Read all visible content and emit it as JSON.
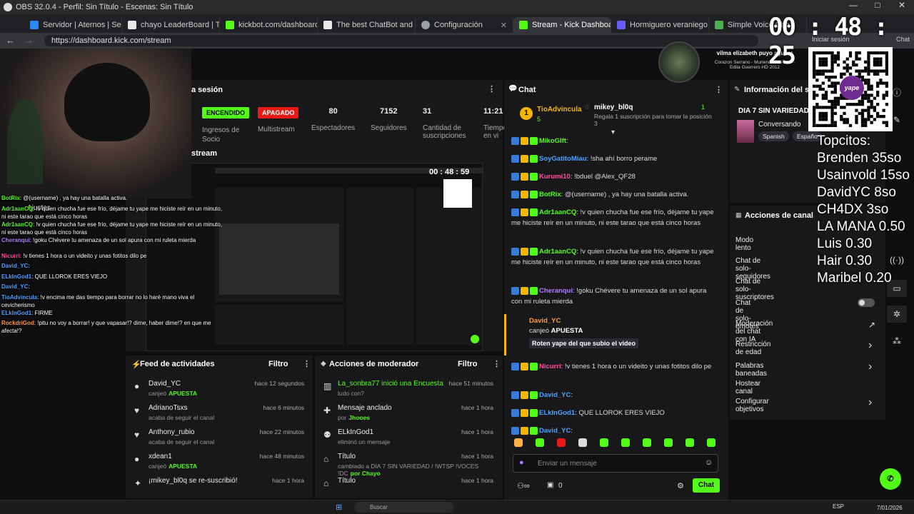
{
  "titlebar": {
    "title": "OBS 32.0.4 - Perfil: Sin Título - Escenas: Sin Título",
    "buttons": [
      "—",
      "□",
      "✕"
    ]
  },
  "browser": {
    "tabs": [
      {
        "label": "Servidor | Aternos | Servidor",
        "color": "#2d88ff"
      },
      {
        "label": "chayo LeaderBoard | The be",
        "color": "#e8e8e8"
      },
      {
        "label": "kickbot.com/dashboard/ttsi",
        "color": "#53fc18"
      },
      {
        "label": "The best ChatBot and Widge",
        "color": "#e8e8e8"
      },
      {
        "label": "Configuración",
        "color": "#9aa0a6"
      },
      {
        "label": "Stream - Kick Dashboard",
        "color": "#53fc18"
      },
      {
        "label": "Hormiguero veraniego",
        "color": "#6b5cff"
      },
      {
        "label": "Simple Voice Cha",
        "color": "#4caf50"
      }
    ],
    "url": "https://dashboard.kick.com/stream",
    "signin": "Iniciar sesión",
    "chat_label": "Chat"
  },
  "overlay_timer": {
    "h": "00",
    "m": "48",
    "s": "25"
  },
  "now_playing": {
    "name": "vilma elizabeth puyo aguilar",
    "song": "Corazon Serrano - Muriendo de Amor -",
    "artist": "Edita Guerrero HD 2012"
  },
  "session": {
    "title": "a sesión",
    "badges": {
      "on": "ENCENDIDO",
      "off": "APAGADO"
    },
    "labels": {
      "ingresos": "Ingresos de Socio",
      "multistream": "Multistream"
    },
    "stats": [
      {
        "value": "80",
        "label": "Espectadores"
      },
      {
        "value": "7152",
        "label": "Seguidores"
      },
      {
        "value": "31",
        "label": "Cantidad de suscripciones"
      },
      {
        "value": "11:21",
        "label": "Tiempo en vi"
      }
    ],
    "preview_title": "stream"
  },
  "activity_feed": {
    "title": "Feed de actividades",
    "filter": "Filtro",
    "rows": [
      {
        "icon": "subscribe-icon",
        "name": "David_YC",
        "sub": "canjeó",
        "hl": "APUESTA",
        "time": "hace 12 segundos"
      },
      {
        "icon": "heart-icon",
        "name": "AdrianoTsxs",
        "sub": "acaba de seguir el canal",
        "hl": "",
        "time": "hace 6 minutos"
      },
      {
        "icon": "heart-icon",
        "name": "Anthony_rubio",
        "sub": "acaba de seguir el canal",
        "hl": "",
        "time": "hace 22 minutos"
      },
      {
        "icon": "subscribe-icon",
        "name": "xdean1",
        "sub": "canjeó",
        "hl": "APUESTA",
        "time": "hace 48 minutos"
      },
      {
        "icon": "star-icon",
        "name": "¡mikey_bl0q se re-suscribió!",
        "sub": "",
        "hl": "",
        "time": "hace 1 hora"
      }
    ]
  },
  "mod_actions": {
    "title": "Acciones de moderador",
    "filter": "Filtro",
    "rows": [
      {
        "icon": "poll-icon",
        "name": "La_sonbra77 inició una Encuesta",
        "sub": "ludo con?",
        "hl": "",
        "time": "hace 51 minutos"
      },
      {
        "icon": "pin-icon",
        "name": "Mensaje anclado",
        "sub": "por",
        "hl": "Jhooes",
        "time": "hace 1 hora"
      },
      {
        "icon": "user-icon",
        "name": "ELkInGod1",
        "sub": "eliminó un mensaje",
        "hl": "",
        "time": "hace 1 hora"
      },
      {
        "icon": "title-icon",
        "name": "Título",
        "sub": "cambiado a DIA 7 SIN VARIEDAD / !WTSP !VOCES !DC",
        "hl": "por Chayo",
        "time": "hace 1 hora"
      },
      {
        "icon": "title-icon",
        "name": "Título",
        "sub": "",
        "hl": "",
        "time": "hace 1 hora"
      }
    ]
  },
  "chat": {
    "title": "Chat",
    "pinned": {
      "rank": "1",
      "user": "TioAdvincula",
      "sub_count": "5",
      "gifter": "mikey_bl0q",
      "gift_count": "1",
      "note": "Regala 1 suscripción para tomar la posición 3"
    },
    "messages": [
      {
        "user": "MikoGIft",
        "cls": "u1",
        "text": ""
      },
      {
        "user": "SoyGatitoMiau",
        "cls": "u3",
        "text": "!sha ahí borro perame"
      },
      {
        "user": "Kurumi10",
        "cls": "u2",
        "text": "!bduel @Alex_QF28"
      },
      {
        "user": "BotRix",
        "cls": "u1",
        "text": "@(username) , ya hay una batalla activa."
      },
      {
        "user": "Adr1aanCQ",
        "cls": "u1",
        "text": "!v quien chucha fue ese frío, déjame tu yape me hiciste reír en un minuto, ni este tarao que está cinco horas"
      },
      {
        "user": "Adr1aanCQ",
        "cls": "u1",
        "text": "!v quien chucha fue ese frío, déjame tu yape me hiciste reír en un minuto, ni este tarao que está cinco horas"
      },
      {
        "user": "Cheranqui",
        "cls": "u5",
        "text": "!goku Chévere tu amenaza de un sol apura con mi ruleta mierda"
      }
    ],
    "redeem": {
      "user": "David_YC",
      "action": "canjeó",
      "item": "APUESTA",
      "note": "Roten yape del que subio el video"
    },
    "messages2": [
      {
        "user": "Nicurri",
        "cls": "u2",
        "text": "!v tienes 1 hora o un videito y unas fotitos dilo pe"
      },
      {
        "user": "David_YC",
        "cls": "u3",
        "text": ""
      },
      {
        "user": "ELkInGod1",
        "cls": "u3",
        "text": "QUE LLOROK ERES VIEJO"
      },
      {
        "user": "David_YC",
        "cls": "u3",
        "text": ""
      },
      {
        "user": "TioAdvincula",
        "cls": "u3",
        "text": "!v encima me das tiempo para borrar no lo haré mano viva el cevicherismo"
      },
      {
        "user": "ELkInGod1",
        "cls": "u3",
        "text": "FIRME"
      },
      {
        "user": "RockdriGod",
        "cls": "u4",
        "text": "!pitu no voy a borrar! y que vapasar!? dime, haber dime!? en que me afecta!?"
      }
    ],
    "input_placeholder": "Enviar un mensaje",
    "footer_count": "0",
    "send": "Chat"
  },
  "stream_info": {
    "title": "Información del stre",
    "stream_title": "DIA 7 SIN VARIEDAD /",
    "category": "Conversando",
    "tags": [
      "Spanish",
      "Españo"
    ]
  },
  "channel_actions": {
    "title": "Acciones de canal",
    "items": [
      {
        "label": "Modo lento",
        "kind": "none"
      },
      {
        "label": "Chat de solo-seguidores",
        "kind": "none"
      },
      {
        "label": "Chat de solo-suscriptores",
        "kind": "none"
      },
      {
        "label": "Chat de solo-emotes",
        "kind": "toggle"
      },
      {
        "label": "Moderación del chat con IA",
        "kind": "ext"
      },
      {
        "label": "Restricción de edad",
        "kind": "chev"
      },
      {
        "label": "Palabras baneadas",
        "kind": "chev"
      },
      {
        "label": "Hostear canal",
        "kind": "none"
      },
      {
        "label": "Configurar objetivos",
        "kind": "chev"
      }
    ]
  },
  "topcitos": {
    "title": "Topcitos:",
    "rows": [
      "Brenden 35so",
      "Usainvold 15so",
      "DavidYC 8so",
      "CH4DX 3so",
      "LA MANA 0.50",
      "Luis 0.30",
      "Hair 0.30",
      "Maribel 0.20"
    ]
  },
  "qr": {
    "label": "yape"
  },
  "obs_overlay_chat": [
    {
      "u": "BotRix",
      "t": ": @(username) , ya hay una batalla activa.",
      "c": "#53fc18"
    },
    {
      "u": "Adr1aanCQ",
      "t": ": !v quien chucha fue ese frío, déjame tu yape me hiciste reír en un minuto, ni este tarao que está cinco horas",
      "c": "#53fc18"
    },
    {
      "u": "Adr1aanCQ",
      "t": ": !v quien chucha fue ese frío, déjame tu yape me hiciste reír en un minuto, ni este tarao que está cinco horas",
      "c": "#53fc18"
    },
    {
      "u": "Cheranqui",
      "t": ": !goku Chévere tu amenaza de un sol apura con mi ruleta mierda",
      "c": "#b57bff"
    },
    {
      "u": "Nicurri",
      "t": ": !v tienes 1 hora o un videito y unas fotitos dilo pe",
      "c": "#ff4fa0"
    },
    {
      "u": "David_YC",
      "t": ":",
      "c": "#4da3ff"
    },
    {
      "u": "ELkInGod1",
      "t": ": QUE LLOROK ERES VIEJO",
      "c": "#4da3ff"
    },
    {
      "u": "David_YC",
      "t": ":",
      "c": "#4da3ff"
    },
    {
      "u": "TioAdvincula",
      "t": ": !v encima me das tiempo para borrar no lo haré mano viva el cevicherismo",
      "c": "#4da3ff"
    },
    {
      "u": "ELkInGod1",
      "t": ": FIRME",
      "c": "#4da3ff"
    },
    {
      "u": "RockdriGod",
      "t": ": !pitu no voy a borrar! y que vapasar!? dime, haber dime!? en que me afecta!?",
      "c": "#ff9b3d"
    }
  ],
  "overlay_ajustes": "Ajustes",
  "preview_timer": "00 : 48 : 59",
  "taskbar": {
    "search": "Buscar",
    "lang": "ESP",
    "date": "7/01/2026"
  },
  "colors": {
    "kick_green": "#53fc18",
    "on": "#53fc18",
    "off": "#e91916"
  }
}
